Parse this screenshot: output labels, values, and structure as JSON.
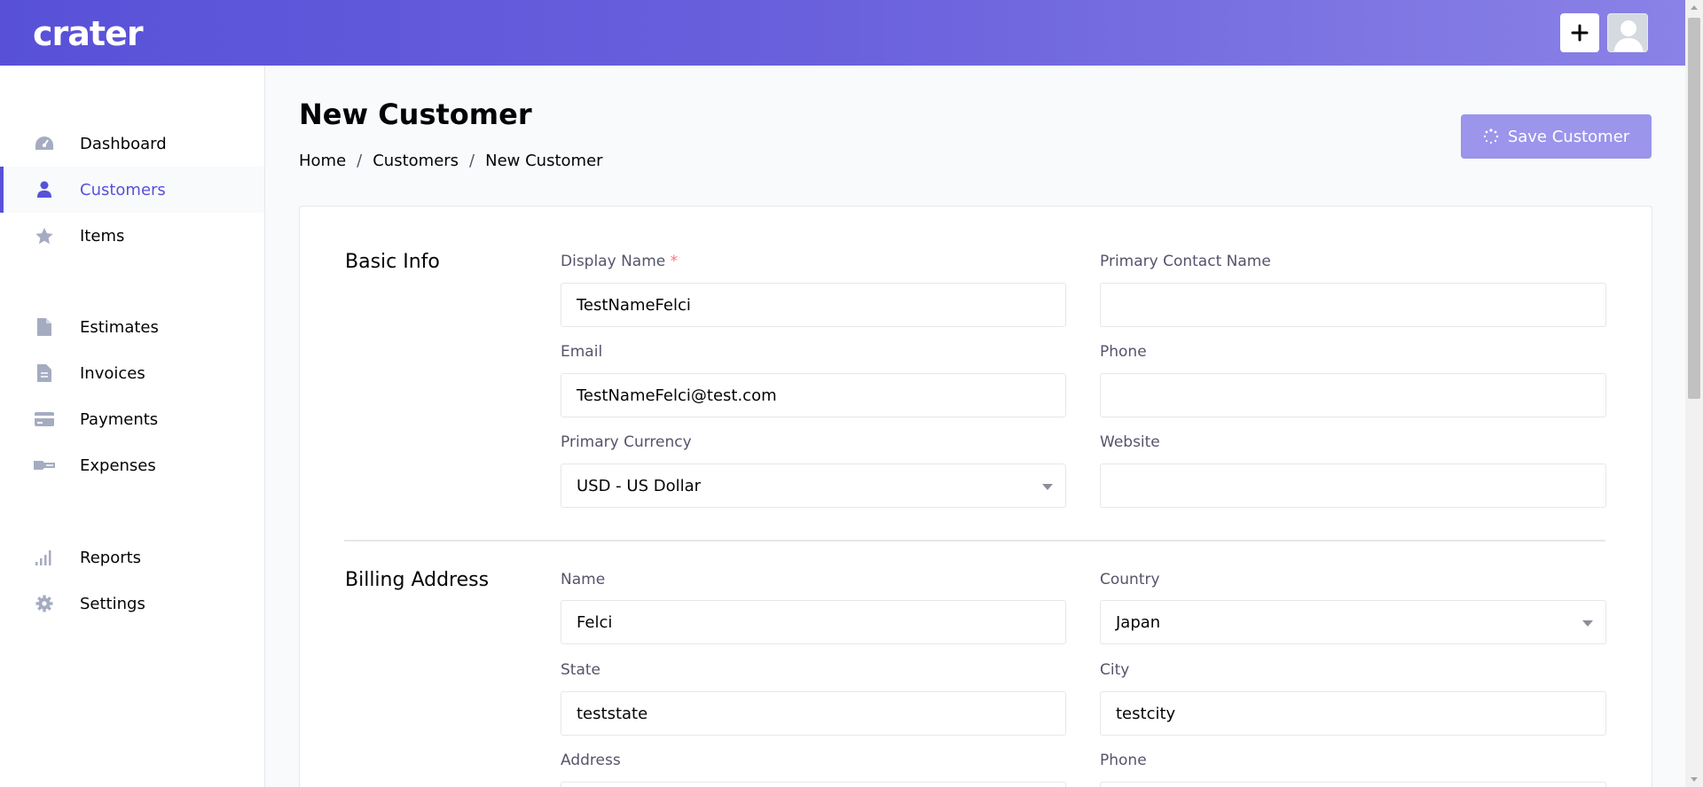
{
  "app": {
    "logo": "crater"
  },
  "topbar": {
    "add_icon": "plus-icon",
    "avatar_icon": "user-avatar-icon"
  },
  "sidebar": {
    "items": [
      {
        "label": "Dashboard",
        "icon": "gauge-icon",
        "active": false
      },
      {
        "label": "Customers",
        "icon": "user-icon",
        "active": true
      },
      {
        "label": "Items",
        "icon": "star-icon",
        "active": false
      },
      {
        "label": "Estimates",
        "icon": "document-icon",
        "active": false
      },
      {
        "label": "Invoices",
        "icon": "invoice-icon",
        "active": false
      },
      {
        "label": "Payments",
        "icon": "credit-card-icon",
        "active": false
      },
      {
        "label": "Expenses",
        "icon": "key-icon",
        "active": false
      },
      {
        "label": "Reports",
        "icon": "bar-signal-icon",
        "active": false
      },
      {
        "label": "Settings",
        "icon": "gear-icon",
        "active": false
      }
    ]
  },
  "header": {
    "title": "New Customer",
    "breadcrumb": [
      "Home",
      "Customers",
      "New Customer"
    ],
    "save_label": "Save Customer"
  },
  "form": {
    "basic_info": {
      "title": "Basic Info",
      "display_name": {
        "label": "Display Name",
        "required_mark": "*",
        "value": "TestNameFelci"
      },
      "primary_contact_name": {
        "label": "Primary Contact Name",
        "value": ""
      },
      "email": {
        "label": "Email",
        "value": "TestNameFelci@test.com"
      },
      "phone": {
        "label": "Phone",
        "value": ""
      },
      "primary_currency": {
        "label": "Primary Currency",
        "value": "USD - US Dollar"
      },
      "website": {
        "label": "Website",
        "value": ""
      }
    },
    "billing_address": {
      "title": "Billing Address",
      "name": {
        "label": "Name",
        "value": "Felci"
      },
      "country": {
        "label": "Country",
        "value": "Japan"
      },
      "state": {
        "label": "State",
        "value": "teststate"
      },
      "city": {
        "label": "City",
        "value": "testcity"
      },
      "address": {
        "label": "Address",
        "value": ""
      },
      "phone": {
        "label": "Phone",
        "value": ""
      }
    }
  },
  "colors": {
    "accent": "#5851d8",
    "button": "#9b95eb",
    "required": "#fb7178"
  }
}
